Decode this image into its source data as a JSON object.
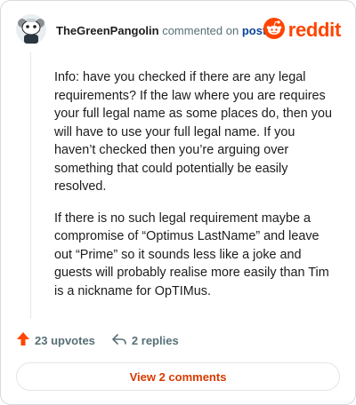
{
  "comment": {
    "username": "TheGreenPangolin",
    "action_text": "commented on",
    "post_link": "post",
    "paragraphs": [
      "Info: have you checked if there are any legal requirements? If the law where you are requires your full legal name as some places do, then you will have to use your full legal name. If you haven’t checked then you’re arguing over something that could potentially be easily resolved.",
      "If there is no such legal requirement maybe a compromise of “Optimus LastName” and leave out “Prime” so it sounds less like a joke and guests will probably realise more easily than Tim is a nickname for OpTIMus."
    ]
  },
  "brand": {
    "name": "reddit",
    "color": "#ff4500"
  },
  "actions": {
    "upvotes": "23 upvotes",
    "replies": "2 replies"
  },
  "view_comments_label": "View 2 comments",
  "icons": {
    "avatar": "snoo-avatar-icon",
    "brand": "reddit-logo-icon",
    "upvote": "upvote-arrow-icon",
    "reply": "reply-arrow-icon"
  }
}
